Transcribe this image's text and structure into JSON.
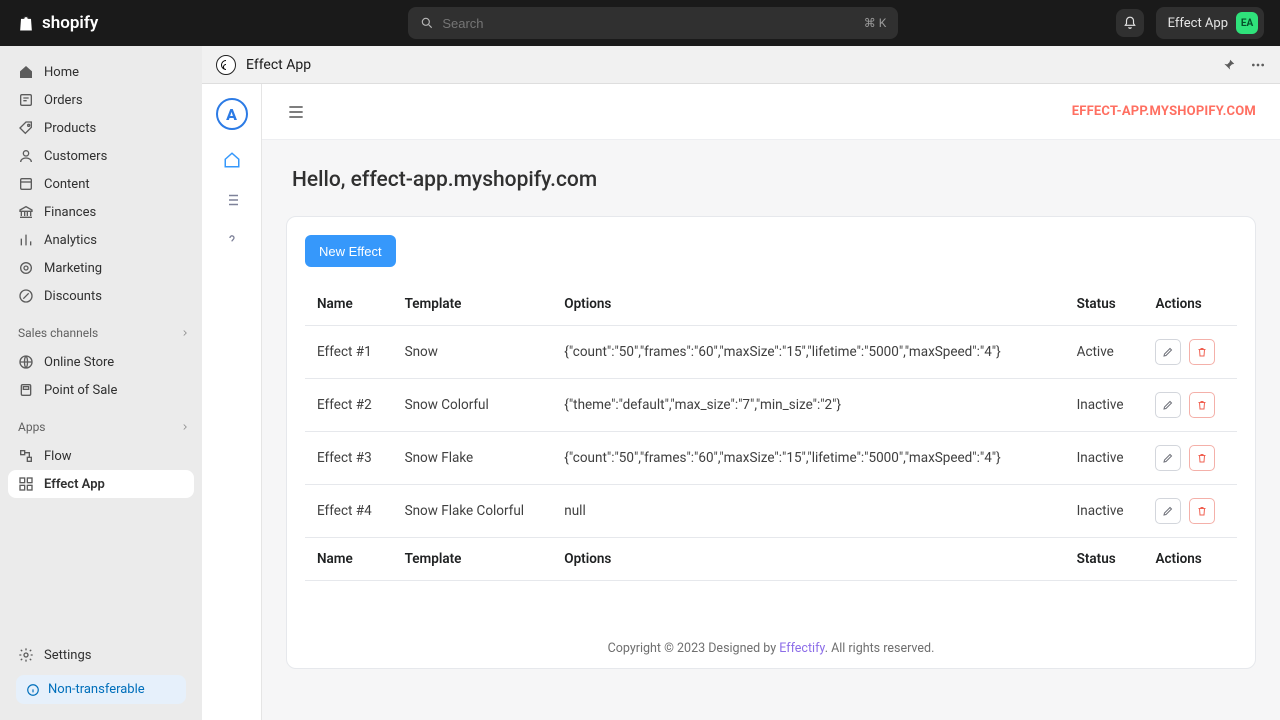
{
  "brand": "shopify",
  "avatar_initials": "EA",
  "search": {
    "placeholder": "Search",
    "shortcut": "⌘ K"
  },
  "topright_app_label": "Effect App",
  "sidebar": {
    "items": [
      {
        "label": "Home",
        "icon": "home"
      },
      {
        "label": "Orders",
        "icon": "orders"
      },
      {
        "label": "Products",
        "icon": "tag"
      },
      {
        "label": "Customers",
        "icon": "person"
      },
      {
        "label": "Content",
        "icon": "content"
      },
      {
        "label": "Finances",
        "icon": "bank"
      },
      {
        "label": "Analytics",
        "icon": "analytics"
      },
      {
        "label": "Marketing",
        "icon": "target"
      },
      {
        "label": "Discounts",
        "icon": "discount"
      }
    ],
    "sales_heading": "Sales channels",
    "sales": [
      {
        "label": "Online Store"
      },
      {
        "label": "Point of Sale"
      }
    ],
    "apps_heading": "Apps",
    "apps": [
      {
        "label": "Flow",
        "active": false
      },
      {
        "label": "Effect App",
        "active": true
      }
    ],
    "settings_label": "Settings",
    "non_transferable": "Non-transferable"
  },
  "app_header": {
    "title": "Effect App"
  },
  "appframe": {
    "shop_domain": "EFFECT-APP.MYSHOPIFY.COM",
    "hello": "Hello, effect-app.myshopify.com",
    "new_effect_label": "New Effect",
    "table": {
      "headers": [
        "Name",
        "Template",
        "Options",
        "Status",
        "Actions"
      ],
      "rows": [
        {
          "name": "Effect #1",
          "template": "Snow",
          "options": "{\"count\":\"50\",\"frames\":\"60\",\"maxSize\":\"15\",\"lifetime\":\"5000\",\"maxSpeed\":\"4\"}",
          "status": "Active"
        },
        {
          "name": "Effect #2",
          "template": "Snow Colorful",
          "options": "{\"theme\":\"default\",\"max_size\":\"7\",\"min_size\":\"2\"}",
          "status": "Inactive"
        },
        {
          "name": "Effect #3",
          "template": "Snow Flake",
          "options": "{\"count\":\"50\",\"frames\":\"60\",\"maxSize\":\"15\",\"lifetime\":\"5000\",\"maxSpeed\":\"4\"}",
          "status": "Inactive"
        },
        {
          "name": "Effect #4",
          "template": "Snow Flake Colorful",
          "options": "null",
          "status": "Inactive"
        }
      ]
    },
    "footer": {
      "prefix": "Copyright © 2023 Designed by ",
      "link": "Effectify",
      "suffix": ". All rights reserved."
    }
  }
}
